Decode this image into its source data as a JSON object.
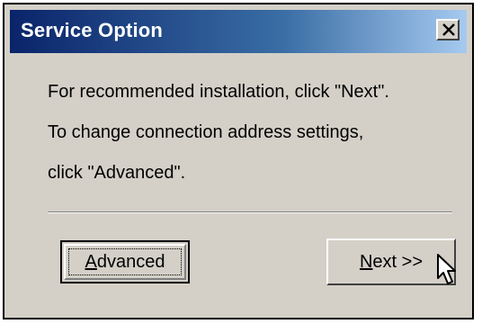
{
  "window": {
    "title": "Service Option",
    "close_label": "X"
  },
  "message": {
    "line1": "For recommended installation, click \"Next\".",
    "line2": "To change connection address settings,",
    "line3": "click \"Advanced\"."
  },
  "buttons": {
    "advanced": {
      "prefix": "",
      "accel": "A",
      "rest": "dvanced"
    },
    "next": {
      "prefix": "",
      "accel": "N",
      "rest": "ext >>"
    }
  },
  "colors": {
    "face": "#d4d0c8",
    "title_start": "#0a246a",
    "title_end": "#a6caf0"
  },
  "icons": {
    "close": "close-x-icon",
    "cursor": "mouse-pointer-icon"
  }
}
